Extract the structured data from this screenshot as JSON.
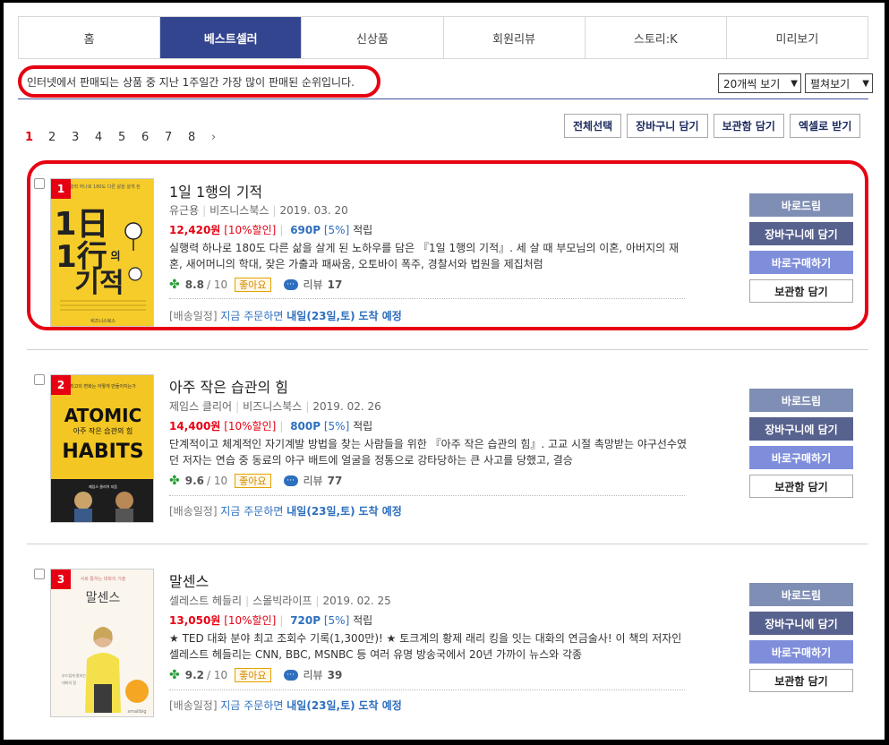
{
  "nav": {
    "tabs": [
      "홈",
      "베스트셀러",
      "신상품",
      "회원리뷰",
      "스토리:K",
      "미리보기"
    ],
    "active": 1
  },
  "description": "인터넷에서 판매되는 상품 중 지난 1주일간 가장 많이 판매된 순위입니다.",
  "view_select": {
    "count": "20개씩 보기",
    "mode": "펼쳐보기"
  },
  "pagination": {
    "pages": [
      "1",
      "2",
      "3",
      "4",
      "5",
      "6",
      "7",
      "8"
    ],
    "current": "1",
    "next": "›"
  },
  "actions": {
    "select_all": "전체선택",
    "cart": "장바구니 담기",
    "wishlist": "보관함 담기",
    "excel": "엑셀로 받기"
  },
  "item_buttons": {
    "direct": "바로드림",
    "cart": "장바구니에 담기",
    "buy": "바로구매하기",
    "keep": "보관함 담기"
  },
  "items": [
    {
      "rank": "1",
      "title": "1일 1행의 기적",
      "author": "유근용",
      "publisher": "비즈니스북스",
      "date": "2019. 03. 20",
      "price": "12,420원",
      "discount": "[10%할인]",
      "points": "690P",
      "points_rate": "[5%]",
      "points_label": "적립",
      "blurb": "실행력 하나로 180도 다른 삶을 살게 된 노하우를 담은 『1일 1행의 기적』. 세 살 때 부모님의 이혼, 아버지의 재혼, 새어머니의 학대, 잦은 가출과 패싸움, 오토바이 폭주, 경찰서와 법원을 제집처럼",
      "rating": "8.8",
      "rating_max": "/ 10",
      "badge": "좋아요",
      "review_label": "리뷰",
      "review_count": "17",
      "ship_label": "[배송일정]",
      "ship_text": "지금 주문하면",
      "ship_date": "내일(23일,토)",
      "ship_arrive": "도착 예정",
      "cover": {
        "bg": "#f6cc2a",
        "top": "실행력 하나로 180도 다른 삶을 살게 된",
        "big": "1日 1行의 기적",
        "bottom": "비즈니스북스"
      }
    },
    {
      "rank": "2",
      "title": "아주 작은 습관의 힘",
      "author": "제임스 클리어",
      "publisher": "비즈니스북스",
      "date": "2019. 02. 26",
      "price": "14,400원",
      "discount": "[10%할인]",
      "points": "800P",
      "points_rate": "[5%]",
      "points_label": "적립",
      "blurb": "단계적이고 체계적인 자기계발 방법을 찾는 사람들을 위한 『아주 작은 습관의 힘』. 고교 시절 촉망받는 야구선수였던 저자는 연습 중 동료의 야구 배트에 얼굴을 정통으로 강타당하는 큰 사고를 당했고, 결승",
      "rating": "9.6",
      "rating_max": "/ 10",
      "badge": "좋아요",
      "review_label": "리뷰",
      "review_count": "77",
      "ship_label": "[배송일정]",
      "ship_text": "지금 주문하면",
      "ship_date": "내일(23일,토)",
      "ship_arrive": "도착 예정",
      "cover": {
        "bg": "#f3c623",
        "top": "최고의 변화는 어떻게 만들어지는가",
        "big": "ATOMIC HABITS",
        "bottom": "아주 작은 습관의 힘"
      }
    },
    {
      "rank": "3",
      "title": "말센스",
      "author": "셀레스트 헤들리",
      "publisher": "스몰빅라이프",
      "date": "2019. 02. 25",
      "price": "13,050원",
      "discount": "[10%할인]",
      "points": "720P",
      "points_rate": "[5%]",
      "points_label": "적립",
      "blurb": "★ TED 대화 분야 최고 조회수 기록(1,300만)! ★ 토크계의 황제 래리 킹을 잇는 대화의 연금술사! 이 책의 저자인 셀레스트 헤들리는 CNN, BBC, MSNBC 등 여러 유명 방송국에서 20년 가까이 뉴스와 각종",
      "rating": "9.2",
      "rating_max": "/ 10",
      "badge": "좋아요",
      "review_label": "리뷰",
      "review_count": "39",
      "ship_label": "[배송일정]",
      "ship_text": "지금 주문하면",
      "ship_date": "내일(23일,토)",
      "ship_arrive": "도착 예정",
      "cover": {
        "bg": "#faf6ee",
        "top": "서로 통하는 대화의 기술",
        "big": "말센스",
        "bottom": "smallbig life"
      }
    }
  ]
}
